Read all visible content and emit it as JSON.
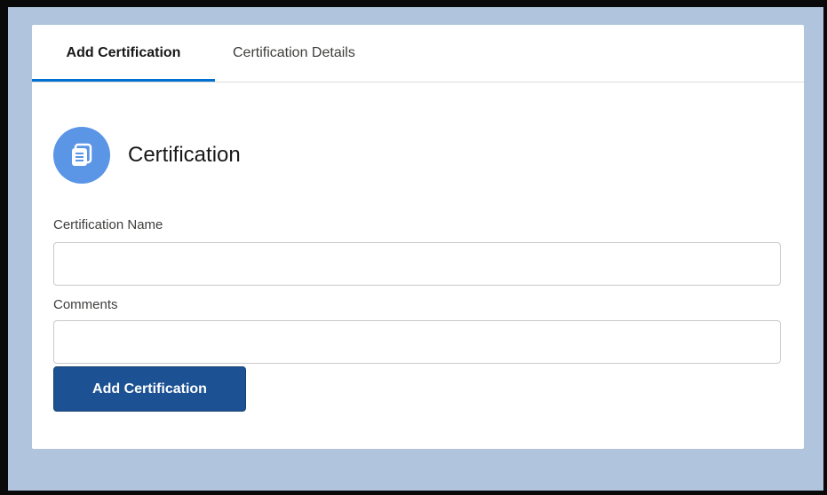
{
  "tabs": [
    {
      "label": "Add Certification",
      "active": true
    },
    {
      "label": "Certification Details",
      "active": false
    }
  ],
  "header": {
    "icon": "document-stack-icon",
    "title": "Certification"
  },
  "form": {
    "name_label": "Certification Name",
    "name_value": "",
    "comments_label": "Comments",
    "comments_value": "",
    "submit_label": "Add Certification"
  },
  "colors": {
    "page_background": "#b0c4de",
    "accent": "#0070d2",
    "icon_background": "#5a95e6",
    "button_background": "#1c5193"
  }
}
